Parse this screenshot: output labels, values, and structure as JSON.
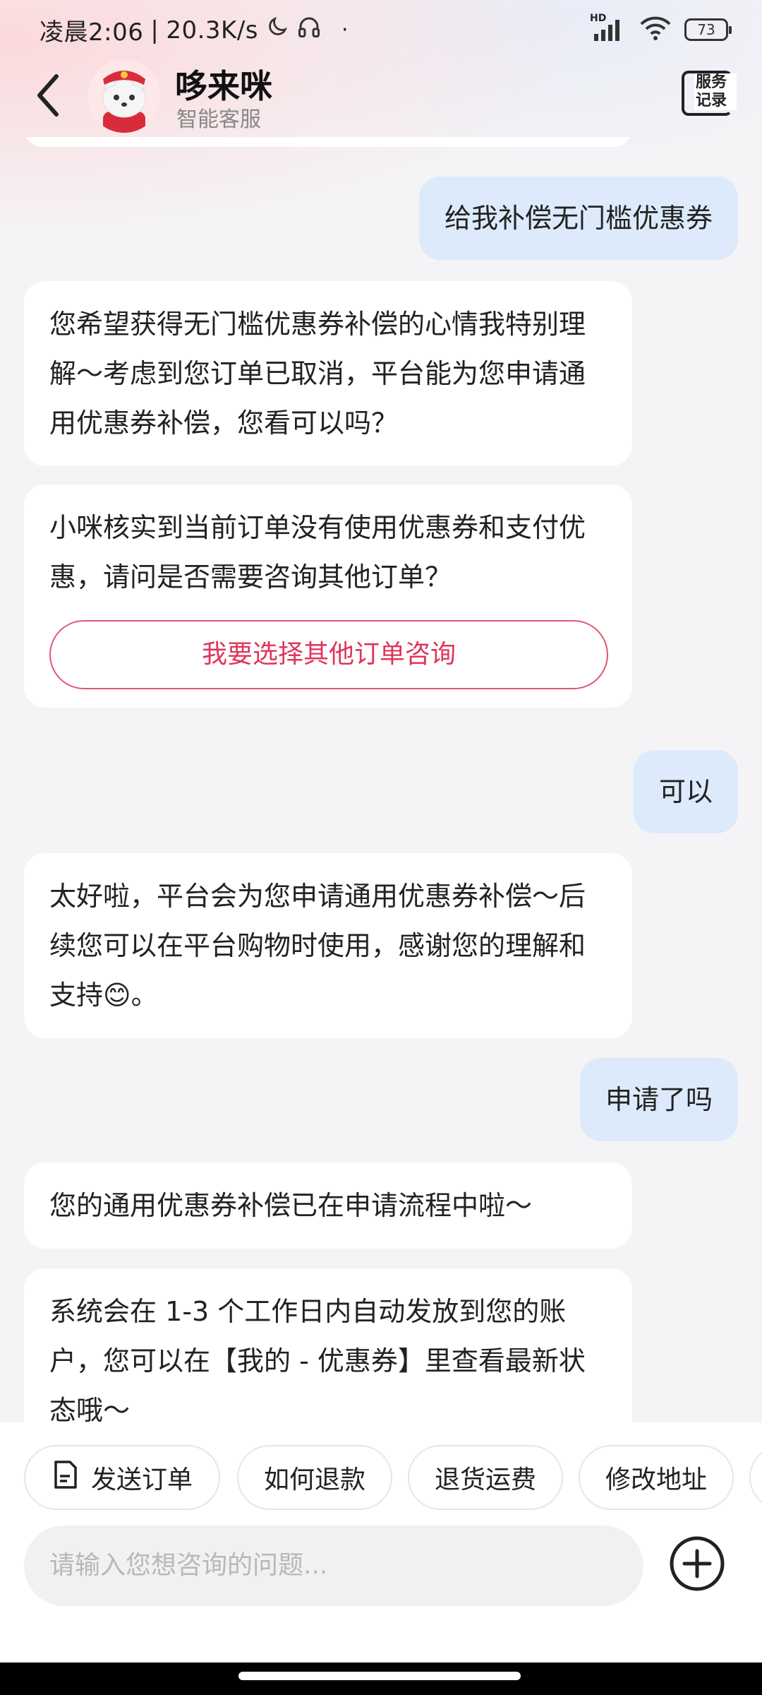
{
  "status_bar": {
    "time": "凌晨2:06",
    "speed": "20.3K/s",
    "network": "HD",
    "battery": "73"
  },
  "header": {
    "title": "哆来咪",
    "subtitle": "智能客服",
    "service_records": "服务记录"
  },
  "messages": [
    {
      "role": "user",
      "text": "给我补偿无门槛优惠券"
    },
    {
      "role": "bot",
      "text": "您希望获得无门槛优惠券补偿的心情我特别理解～考虑到您订单已取消，平台能为您申请通用优惠券补偿，您看可以吗？"
    },
    {
      "role": "bot",
      "text": "小咪核实到当前订单没有使用优惠券和支付优惠，请问是否需要咨询其他订单？",
      "button": "我要选择其他订单咨询"
    },
    {
      "role": "user",
      "text": "可以"
    },
    {
      "role": "bot",
      "text": "太好啦，平台会为您申请通用优惠券补偿～后续您可以在平台购物时使用，感谢您的理解和支持😊。"
    },
    {
      "role": "user",
      "text": "申请了吗"
    },
    {
      "role": "bot",
      "text": "您的通用优惠券补偿已在申请流程中啦～"
    },
    {
      "role": "bot",
      "text": "系统会在 1-3 个工作日内自动发放到您的账户，您可以在【我的 - 优惠券】里查看最新状态哦～"
    }
  ],
  "quick_actions": [
    "发送订单",
    "如何退款",
    "退货运费",
    "修改地址"
  ],
  "input": {
    "placeholder": "请输入您想咨询的问题..."
  },
  "colors": {
    "accent": "#e0355c",
    "user_bubble": "#dceafb",
    "background": "#f4f4f6"
  },
  "icons": [
    "back-arrow-icon",
    "mascot-avatar",
    "service-records-icon",
    "document-icon",
    "plus-circle-icon",
    "moon-icon",
    "headphones-icon",
    "signal-icon",
    "wifi-icon",
    "battery-icon"
  ]
}
